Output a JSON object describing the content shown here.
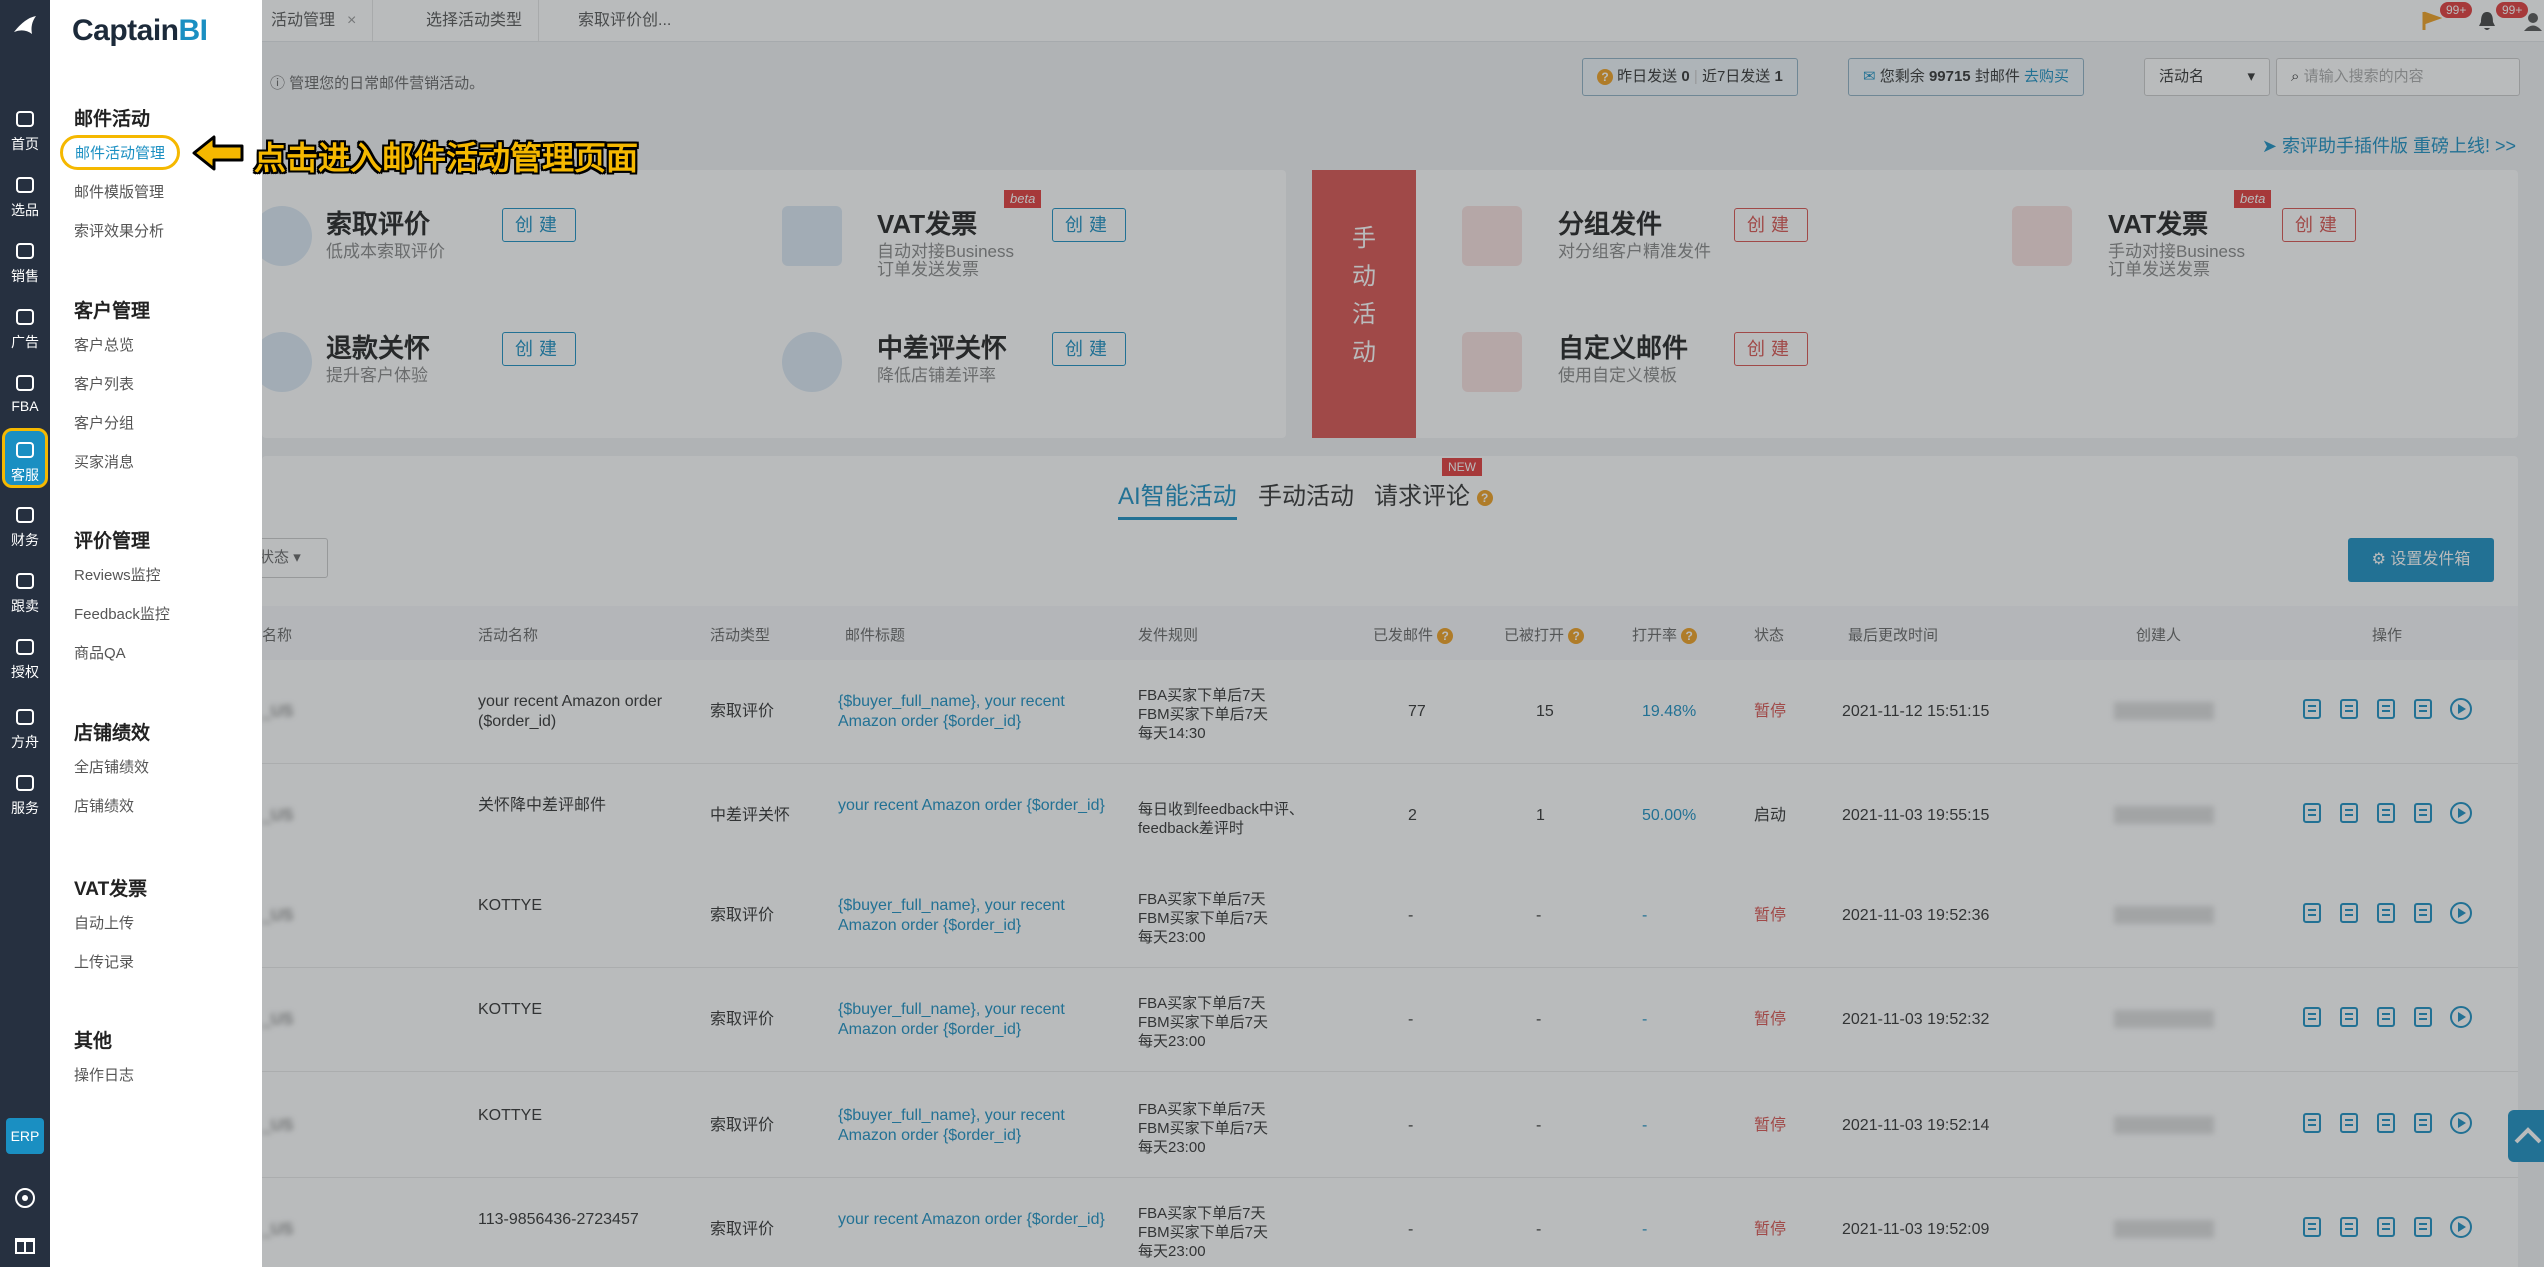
{
  "app": {
    "brand_prefix": "Captain",
    "brand_suffix": "BI"
  },
  "topbar": {
    "tabs": [
      {
        "label": "活动管理",
        "closable": true
      },
      {
        "label": "选择活动类型",
        "closable": false
      },
      {
        "label": "索取评价创...",
        "closable": false
      }
    ],
    "badges": [
      "99+",
      "99+"
    ]
  },
  "subbar": {
    "hint": "管理您的日常邮件营销活动。",
    "sent_yesterday_label": "昨日发送",
    "sent_yesterday_value": "0",
    "sent_week_label": "近7日发送",
    "sent_week_value": "1",
    "remaining_prefix": "您剩余",
    "remaining_value": "99715",
    "remaining_suffix": "封邮件",
    "buy_link": "去购买",
    "search_field_select": "活动名",
    "search_placeholder": "请输入搜索的内容"
  },
  "ext_link": "索评助手插件版 重磅上线! >>",
  "auto_cards": [
    {
      "title": "索取评价",
      "desc": [
        "低成本索取评价"
      ],
      "button": "创建",
      "beta": false
    },
    {
      "title": "VAT发票",
      "desc": [
        "自动对接Business",
        "订单发送发票"
      ],
      "button": "创建",
      "beta": true
    },
    {
      "title": "退款关怀",
      "desc": [
        "提升客户体验"
      ],
      "button": "创建",
      "beta": false
    },
    {
      "title": "中差评关怀",
      "desc": [
        "降低店铺差评率"
      ],
      "button": "创建",
      "beta": false
    }
  ],
  "manual_banner": [
    "手",
    "动",
    "活",
    "动"
  ],
  "manual_cards": [
    {
      "title": "分组发件",
      "desc": [
        "对分组客户精准发件"
      ],
      "button": "创建",
      "beta": false
    },
    {
      "title": "VAT发票",
      "desc": [
        "手动对接Business",
        "订单发送发票"
      ],
      "button": "创建",
      "beta": true
    },
    {
      "title": "自定义邮件",
      "desc": [
        "使用自定义模板"
      ],
      "button": "创建",
      "beta": false
    }
  ],
  "beta_label": "beta",
  "campaign_tabs": [
    {
      "label": "AI智能活动",
      "active": true
    },
    {
      "label": "手动活动",
      "active": false
    },
    {
      "label": "请求评论",
      "active": false
    }
  ],
  "new_label": "NEW",
  "status_filter": "状态",
  "sender_button": "设置发件箱",
  "table": {
    "headers": [
      "名称",
      "活动名称",
      "活动类型",
      "邮件标题",
      "发件规则",
      "已发邮件",
      "已被打开",
      "打开率",
      "状态",
      "最后更改时间",
      "创建人",
      "操作"
    ],
    "rows": [
      {
        "shop": "_US",
        "name": "your recent Amazon order ($order_id)",
        "type": "索取评价",
        "subject": "{$buyer_full_name}, your recent Amazon order {$order_id}",
        "rule": [
          "FBA买家下单后7天",
          "FBM买家下单后7天",
          "每天14:30"
        ],
        "sent": "77",
        "opened": "15",
        "rate": "19.48%",
        "status": "暂停",
        "status_color": "#d9534f",
        "time": "2021-11-12 15:51:15"
      },
      {
        "shop": "_US",
        "name": "关怀降中差评邮件",
        "type": "中差评关怀",
        "subject": "your recent Amazon order {$order_id}",
        "rule": [
          "每日收到feedback中评、",
          "feedback差评时"
        ],
        "sent": "2",
        "opened": "1",
        "rate": "50.00%",
        "status": "启动",
        "status_color": "#333333",
        "time": "2021-11-03 19:55:15"
      },
      {
        "shop": "_US",
        "name": "KOTTYE",
        "type": "索取评价",
        "subject": "{$buyer_full_name}, your recent Amazon order {$order_id}",
        "rule": [
          "FBA买家下单后7天",
          "FBM买家下单后7天",
          "每天23:00"
        ],
        "sent": "-",
        "opened": "-",
        "rate": "-",
        "status": "暂停",
        "status_color": "#d9534f",
        "time": "2021-11-03 19:52:36"
      },
      {
        "shop": "_US",
        "name": "KOTTYE",
        "type": "索取评价",
        "subject": "{$buyer_full_name}, your recent Amazon order {$order_id}",
        "rule": [
          "FBA买家下单后7天",
          "FBM买家下单后7天",
          "每天23:00"
        ],
        "sent": "-",
        "opened": "-",
        "rate": "-",
        "status": "暂停",
        "status_color": "#d9534f",
        "time": "2021-11-03 19:52:32"
      },
      {
        "shop": "_US",
        "name": "KOTTYE",
        "type": "索取评价",
        "subject": "{$buyer_full_name}, your recent Amazon order {$order_id}",
        "rule": [
          "FBA买家下单后7天",
          "FBM买家下单后7天",
          "每天23:00"
        ],
        "sent": "-",
        "opened": "-",
        "rate": "-",
        "status": "暂停",
        "status_color": "#d9534f",
        "time": "2021-11-03 19:52:14"
      },
      {
        "shop": "_US",
        "name": "113-9856436-2723457",
        "type": "索取评价",
        "subject": "your recent Amazon order {$order_id}",
        "rule": [
          "FBA买家下单后7天",
          "FBM买家下单后7天",
          "每天23:00"
        ],
        "sent": "-",
        "opened": "-",
        "rate": "-",
        "status": "暂停",
        "status_color": "#d9534f",
        "time": "2021-11-03 19:52:09"
      }
    ]
  },
  "rail": [
    {
      "label": "首页",
      "icon": "home-icon"
    },
    {
      "label": "选品",
      "icon": "search-icon"
    },
    {
      "label": "销售",
      "icon": "chart-icon"
    },
    {
      "label": "广告",
      "icon": "ad-icon"
    },
    {
      "label": "FBA",
      "icon": "warehouse-icon"
    },
    {
      "label": "客服",
      "icon": "service-icon",
      "active": true
    },
    {
      "label": "财务",
      "icon": "finance-icon"
    },
    {
      "label": "跟卖",
      "icon": "pie-icon"
    },
    {
      "label": "授权",
      "icon": "shield-icon"
    },
    {
      "label": "方舟",
      "icon": "ark-icon"
    },
    {
      "label": "服务",
      "icon": "briefcase-icon"
    }
  ],
  "erp_label": "ERP",
  "menu": [
    {
      "head": "邮件活动",
      "items": [
        "邮件活动管理",
        "邮件模版管理",
        "索评效果分析"
      ],
      "active_index": 0
    },
    {
      "head": "客户管理",
      "items": [
        "客户总览",
        "客户列表",
        "客户分组",
        "买家消息"
      ]
    },
    {
      "head": "评价管理",
      "items": [
        "Reviews监控",
        "Feedback监控",
        "商品QA"
      ]
    },
    {
      "head": "店铺绩效",
      "items": [
        "全店铺绩效",
        "店铺绩效"
      ]
    },
    {
      "head": "VAT发票",
      "items": [
        "自动上传",
        "上传记录"
      ]
    },
    {
      "head": "其他",
      "items": [
        "操作日志"
      ]
    }
  ],
  "callout": "点击进入邮件活动管理页面",
  "colors": {
    "accent": "#1a8fc2",
    "highlight": "#f5b800",
    "danger": "#d9534f",
    "rail": "#263040"
  }
}
